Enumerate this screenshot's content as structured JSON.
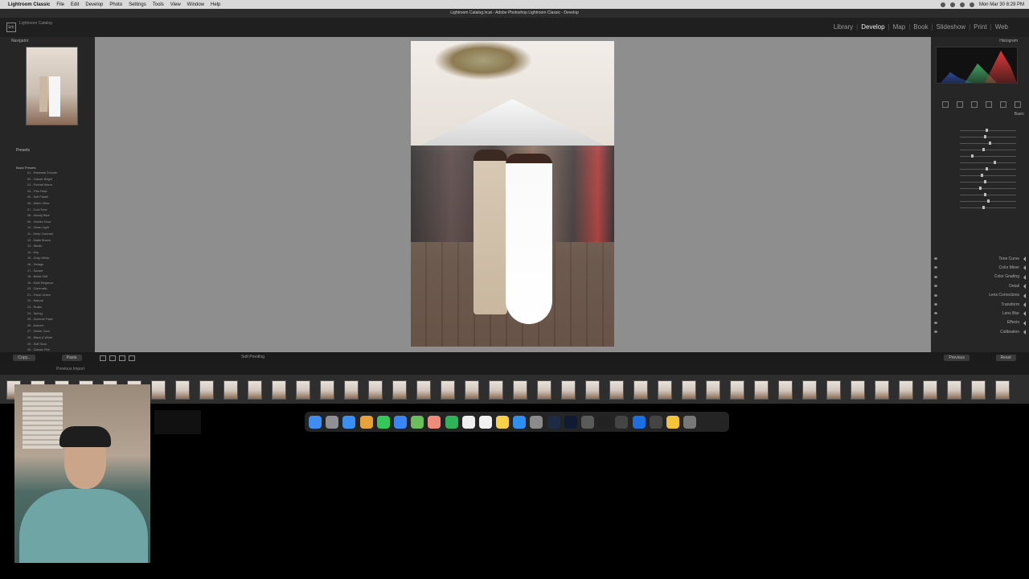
{
  "menubar": {
    "items": [
      "Lightroom Classic",
      "File",
      "Edit",
      "Develop",
      "Photo",
      "Settings",
      "Tools",
      "View",
      "Window",
      "Help"
    ],
    "clock": "Mon Mar 30 8:29 PM"
  },
  "window": {
    "title": "Lightroom Catalog.lrcat - Adobe Photoshop Lightroom Classic - Develop"
  },
  "module_bar": {
    "logo": "Lrc",
    "catalog_name": "Lightroom Catalog",
    "modules": [
      "Library",
      "Develop",
      "Map",
      "Book",
      "Slideshow",
      "Print",
      "Web"
    ],
    "active": "Develop"
  },
  "left_panel": {
    "navigator_label": "Navigator",
    "presets_label": "Presets",
    "preset_group": "Basic Presets",
    "preset_rows": [
      "01 - Essential Smooth",
      "02 - Classic Bright",
      "03 - Portrait Warm",
      "04 - Film Fade",
      "05 - Soft Pastel",
      "06 - Warm Glow",
      "07 - Cool Tone",
      "08 - Moody Blue",
      "09 - Golden Hour",
      "10 - Clean Light",
      "11 - Deep Contrast",
      "12 - Matte Brown",
      "13 - Studio",
      "14 - Airy",
      "15 - Crisp White",
      "16 - Vintage",
      "17 - Sunset",
      "18 - Bridal Soft",
      "19 - Dark Elegance",
      "20 - Cinematic",
      "21 - Fresh Green",
      "22 - Natural",
      "23 - Rustic",
      "24 - Spring",
      "25 - Summer Fade",
      "26 - Autumn",
      "27 - Winter Cool",
      "28 - Black & White",
      "29 - Soft Glow",
      "30 - Classic Film"
    ],
    "copy_button": "Copy...",
    "paste_button": "Paste"
  },
  "toolbar": {
    "soft_proofing": "Soft Proofing"
  },
  "right_panel": {
    "histogram_label": "Histogram",
    "basic_label": "Basic",
    "sections": [
      "Tone Curve",
      "Color Mixer",
      "Color Grading",
      "Detail",
      "Lens Corrections",
      "Transform",
      "Lens Blur",
      "Effects",
      "Calibration"
    ],
    "previous_button": "Previous",
    "reset_button": "Reset"
  },
  "filmstrip": {
    "source": "Previous Import"
  }
}
